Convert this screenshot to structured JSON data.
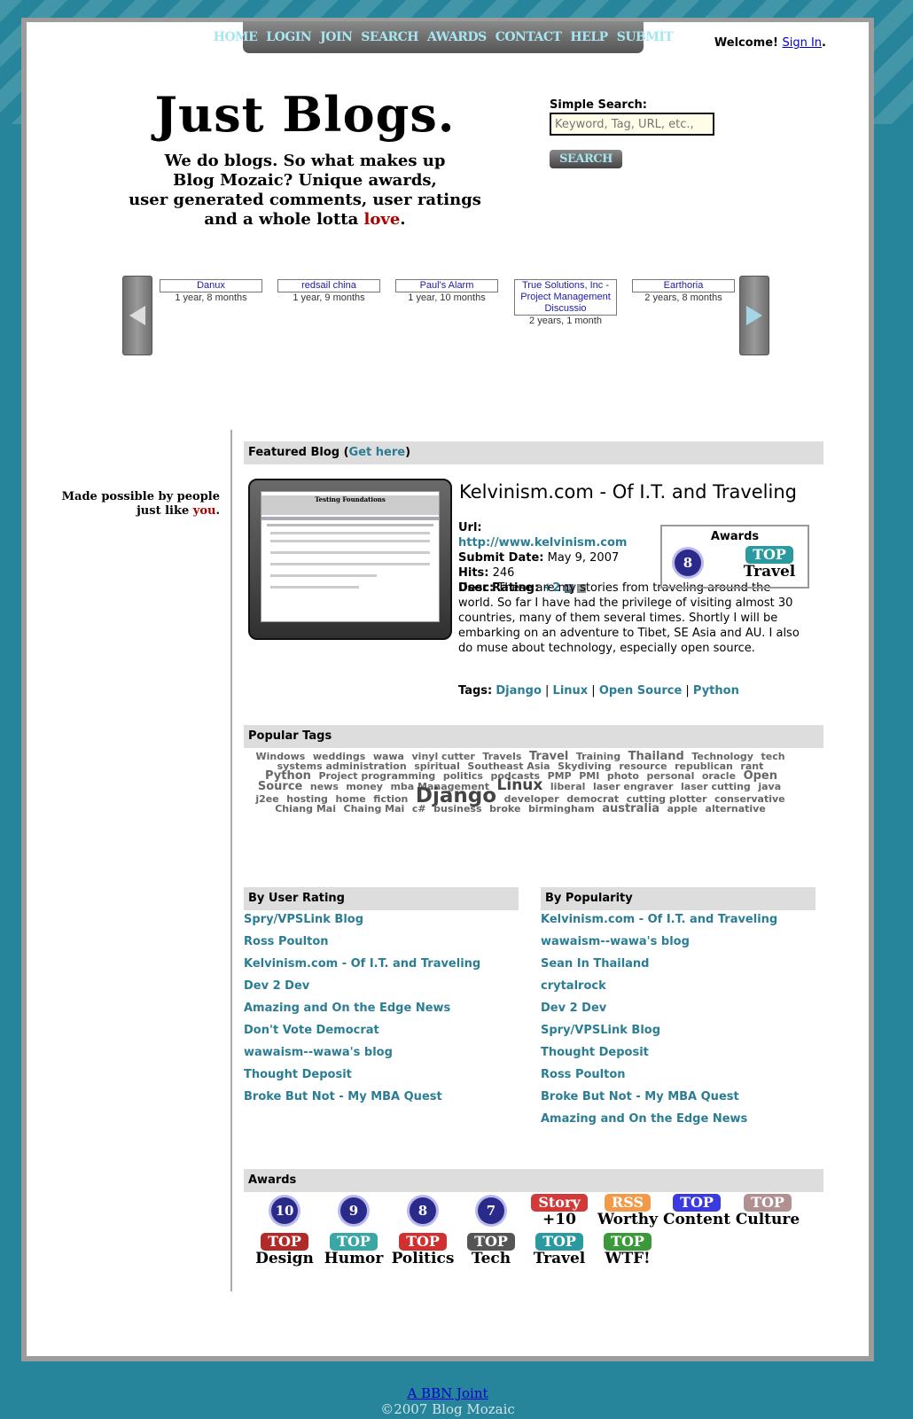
{
  "nav": {
    "items": [
      "HOME",
      "LOGIN",
      "JOIN",
      "SEARCH",
      "AWARDS",
      "CONTACT",
      "HELP",
      "SUBMIT"
    ]
  },
  "welcome": {
    "text": "Welcome!",
    "sign_in": "Sign In",
    "period": "."
  },
  "header": {
    "title": "Just Blogs.",
    "tagline_1": "We do blogs.  So what makes up",
    "tagline_2": "Blog Mozaic? Unique awards,",
    "tagline_3": "user generated comments, user ratings",
    "tagline_4_pre": "and a whole lotta ",
    "tagline_love": "love",
    "tagline_4_post": "."
  },
  "search": {
    "label": "Simple Search:",
    "placeholder": "Keyword, Tag, URL, etc.,",
    "button": "SEARCH"
  },
  "carousel": {
    "items": [
      {
        "name": "Danux",
        "age": "1 year, 8 months"
      },
      {
        "name": "redsail china",
        "age": "1 year, 9 months"
      },
      {
        "name": "Paul's Alarm",
        "age": "1 year, 10 months"
      },
      {
        "name": "True Solutions, Inc - Project Management Discussio",
        "age": "2 years, 1 month"
      },
      {
        "name": "Earthoria",
        "age": "2 years, 8 months"
      }
    ]
  },
  "sidebar": {
    "made_possible": "Made possible by people",
    "just_like": "just like ",
    "you": "you",
    "period": "."
  },
  "featured": {
    "heading_pre": "Featured Blog (",
    "heading_link": "Get here",
    "heading_post": ")",
    "thumb_title": "Testing Foundations",
    "title": "Kelvinism.com - Of I.T. and Traveling",
    "url_label": "Url:",
    "url": "http://www.kelvinism.com",
    "date_label": "Submit Date:",
    "date": "May 9, 2007",
    "hits_label": "Hits:",
    "hits": "246",
    "rating_label": "User Rating:",
    "rating": "+2",
    "desc_label": "Desc:",
    "desc": "These are my stories from traveling around the world. So far I have had the privilege of visiting almost 30 countries, many of them several times. Shortly I will be embarking on an adventure to Tibet, SE Asia and AU. I also do muse about technology, especially open source.",
    "tags_label": "Tags:",
    "tags": [
      "Django",
      "Linux",
      "Open Source",
      "Python"
    ],
    "awards_title": "Awards",
    "award_badge": "8",
    "award_top": "TOP",
    "award_sub": "Travel"
  },
  "popular_tags": {
    "heading": "Popular Tags",
    "tags": [
      {
        "t": "Windows",
        "s": 11
      },
      {
        "t": "weddings",
        "s": 11
      },
      {
        "t": "wawa",
        "s": 11
      },
      {
        "t": "vinyl cutter",
        "s": 11
      },
      {
        "t": "Travels",
        "s": 11
      },
      {
        "t": "Travel",
        "s": 13
      },
      {
        "t": "Training",
        "s": 11
      },
      {
        "t": "Thailand",
        "s": 13
      },
      {
        "t": "Technology",
        "s": 11
      },
      {
        "t": "tech",
        "s": 11
      },
      {
        "t": "systems administration",
        "s": 11
      },
      {
        "t": "spiritual",
        "s": 11
      },
      {
        "t": "Southeast Asia",
        "s": 11
      },
      {
        "t": "Skydiving",
        "s": 11
      },
      {
        "t": "resource",
        "s": 11
      },
      {
        "t": "republican",
        "s": 11
      },
      {
        "t": "rant",
        "s": 11
      },
      {
        "t": "Python",
        "s": 13
      },
      {
        "t": "Project programming",
        "s": 11
      },
      {
        "t": "politics",
        "s": 11
      },
      {
        "t": "podcasts",
        "s": 11
      },
      {
        "t": "PMP",
        "s": 11
      },
      {
        "t": "PMI",
        "s": 11
      },
      {
        "t": "photo",
        "s": 11
      },
      {
        "t": "personal",
        "s": 11
      },
      {
        "t": "oracle",
        "s": 11
      },
      {
        "t": "Open Source",
        "s": 13
      },
      {
        "t": "news",
        "s": 11
      },
      {
        "t": "money",
        "s": 11
      },
      {
        "t": "mba Management",
        "s": 11
      },
      {
        "t": "Linux",
        "s": 17
      },
      {
        "t": "liberal",
        "s": 11
      },
      {
        "t": "laser engraver",
        "s": 11
      },
      {
        "t": "laser cutting",
        "s": 11
      },
      {
        "t": "java",
        "s": 11
      },
      {
        "t": "j2ee",
        "s": 11
      },
      {
        "t": "hosting",
        "s": 11
      },
      {
        "t": "home",
        "s": 11
      },
      {
        "t": "fiction",
        "s": 11
      },
      {
        "t": "Django",
        "s": 23
      },
      {
        "t": "developer",
        "s": 11
      },
      {
        "t": "democrat",
        "s": 11
      },
      {
        "t": "cutting plotter",
        "s": 11
      },
      {
        "t": "conservative",
        "s": 11
      },
      {
        "t": "Chiang Mai",
        "s": 11
      },
      {
        "t": "Chaing Mai",
        "s": 11
      },
      {
        "t": "c#",
        "s": 11
      },
      {
        "t": "business",
        "s": 11
      },
      {
        "t": "broke",
        "s": 11
      },
      {
        "t": "birmingham",
        "s": 11
      },
      {
        "t": "australia",
        "s": 13
      },
      {
        "t": "apple",
        "s": 11
      },
      {
        "t": "alternative",
        "s": 11
      }
    ]
  },
  "by_rating": {
    "heading": "By User Rating",
    "items": [
      "Spry/VPSLink Blog",
      "Ross Poulton",
      "Kelvinism.com - Of I.T. and Traveling",
      "Dev 2 Dev",
      "Amazing and On the Edge News",
      "Don't Vote Democrat",
      "wawaism--wawa's blog",
      "Thought Deposit",
      "Broke But Not - My MBA Quest"
    ]
  },
  "by_popularity": {
    "heading": "By Popularity",
    "items": [
      "Kelvinism.com - Of I.T. and Traveling",
      "wawaism--wawa's blog",
      "Sean In Thailand",
      "crytalrock",
      "Dev 2 Dev",
      "Spry/VPSLink Blog",
      "Thought Deposit",
      "Ross Poulton",
      "Broke But Not - My MBA Quest",
      "Amazing and On the Edge News"
    ]
  },
  "awards": {
    "heading": "Awards",
    "row1": [
      {
        "kind": "num",
        "label": "10"
      },
      {
        "kind": "num",
        "label": "9"
      },
      {
        "kind": "num",
        "label": "8"
      },
      {
        "kind": "num",
        "label": "7"
      },
      {
        "kind": "pill",
        "label": "Story",
        "sub": "+10",
        "color": "#d23a3a"
      },
      {
        "kind": "pill",
        "label": "RSS",
        "sub": "Worthy",
        "color": "#f09a4a"
      },
      {
        "kind": "pill",
        "label": "TOP",
        "sub": "Content",
        "color": "#3a3ae0"
      },
      {
        "kind": "pill",
        "label": "TOP",
        "sub": "Culture",
        "color": "#b09090"
      }
    ],
    "row2": [
      {
        "label": "TOP",
        "sub": "Design",
        "color": "#b02a2a"
      },
      {
        "label": "TOP",
        "sub": "Humor",
        "color": "#3aa6a6"
      },
      {
        "label": "TOP",
        "sub": "Politics",
        "color": "#d03030"
      },
      {
        "label": "TOP",
        "sub": "Tech",
        "color": "#555555"
      },
      {
        "label": "TOP",
        "sub": "Travel",
        "color": "#2a9aa0"
      },
      {
        "label": "TOP",
        "sub": "WTF!",
        "color": "#3a9a3a"
      }
    ]
  },
  "footer": {
    "link": "A BBN Joint",
    "copy": "©2007 Blog Mozaic"
  },
  "colors": {
    "background": "#27859b",
    "link": "#2b7d93",
    "accent_red": "#aa0000"
  }
}
